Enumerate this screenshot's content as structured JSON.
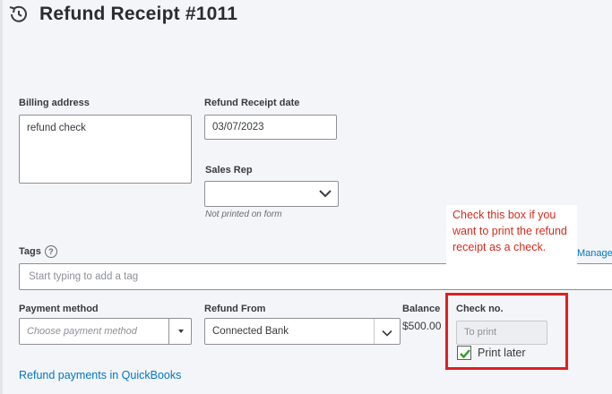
{
  "header": {
    "title": "Refund Receipt #1011",
    "icon": "history-icon"
  },
  "billing": {
    "label": "Billing address",
    "value": "refund check"
  },
  "receipt_date": {
    "label": "Refund Receipt date",
    "value": "03/07/2023"
  },
  "sales_rep": {
    "label": "Sales Rep",
    "value": "",
    "note": "Not printed on form"
  },
  "tooltip": {
    "text": "Check this box if you want to print the refund receipt as a check."
  },
  "tags": {
    "label": "Tags",
    "help": "?",
    "placeholder": "Start typing to add a tag",
    "manage_link": "Manage ta"
  },
  "payment_method": {
    "label": "Payment method",
    "placeholder": "Choose payment method"
  },
  "refund_from": {
    "label": "Refund From",
    "value": "Connected Bank"
  },
  "balance": {
    "label": "Balance",
    "value": "$500.00"
  },
  "check": {
    "label": "Check no.",
    "placeholder": "To print",
    "print_later_label": "Print later",
    "print_later_checked": true
  },
  "footer": {
    "link": "Refund payments in QuickBooks"
  },
  "colors": {
    "accent": "#0077c5",
    "highlight": "#e02020",
    "check_green": "#2ca01c",
    "tooltip_text": "#d52b1e"
  }
}
